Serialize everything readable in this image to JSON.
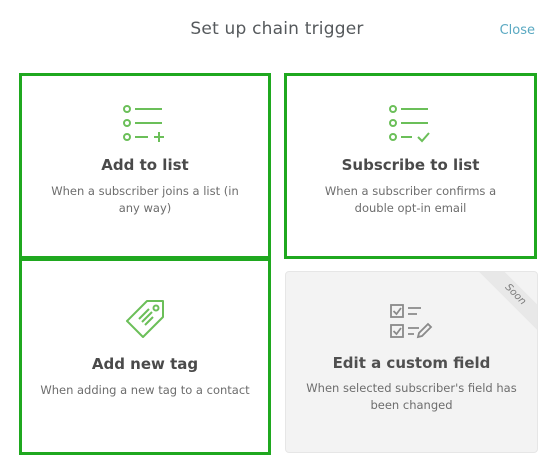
{
  "header": {
    "title": "Set up chain trigger",
    "close_label": "Close"
  },
  "cards": [
    {
      "icon": "list-add-icon",
      "title": "Add to list",
      "description": "When a subscriber joins a list (in any way)",
      "highlighted": true
    },
    {
      "icon": "list-check-icon",
      "title": "Subscribe to list",
      "description": "When a subscriber confirms a double opt-in email",
      "highlighted": true
    },
    {
      "icon": "tag-icon",
      "title": "Add new tag",
      "description": "When adding a new tag to a contact",
      "highlighted": true
    },
    {
      "icon": "checklist-edit-icon",
      "title": "Edit a custom field",
      "description": "When selected subscriber's field has been changed",
      "badge": "Soon",
      "disabled": true
    }
  ],
  "colors": {
    "accent": "#6bbf59",
    "highlight": "#1fa81f",
    "link": "#5aa9c2"
  }
}
